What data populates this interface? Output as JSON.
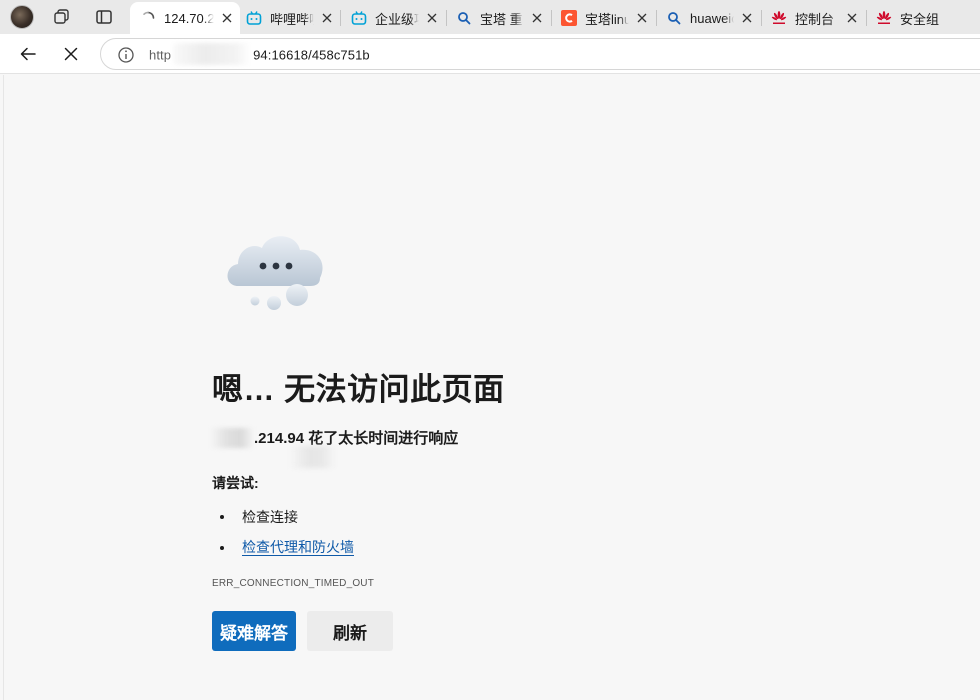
{
  "tabs": [
    {
      "title": "124.70.2",
      "favicon": "loading-spinner-icon",
      "active": true
    },
    {
      "title": "哔哩哔哩",
      "favicon": "bilibili-icon",
      "active": false
    },
    {
      "title": "企业级项",
      "favicon": "bilibili-icon",
      "active": false
    },
    {
      "title": "宝塔 重",
      "favicon": "search-icon",
      "active": false
    },
    {
      "title": "宝塔linu",
      "favicon": "csdn-icon",
      "active": false
    },
    {
      "title": "huaweic",
      "favicon": "search-icon",
      "active": false
    },
    {
      "title": "控制台",
      "favicon": "huawei-icon",
      "active": false
    },
    {
      "title": "安全组",
      "favicon": "huawei-icon",
      "active": false
    }
  ],
  "address_bar": {
    "url_prefix": "http",
    "url_suffix": "94:16618/458c751b"
  },
  "error": {
    "heading": "嗯… 无法访问此页面",
    "subline_host": ".214.94",
    "subline_text": " 花了太长时间进行响应",
    "try_label": "请尝试:",
    "suggestions": [
      {
        "text": "检查连接",
        "link": false
      },
      {
        "text": "检查代理和防火墙",
        "link": true
      }
    ],
    "code": "ERR_CONNECTION_TIMED_OUT",
    "buttons": {
      "troubleshoot": "疑难解答",
      "refresh": "刷新"
    }
  },
  "colors": {
    "primary_button": "#0f6cbd",
    "link": "#0f5aa8",
    "page_background": "#f7f7f7"
  }
}
